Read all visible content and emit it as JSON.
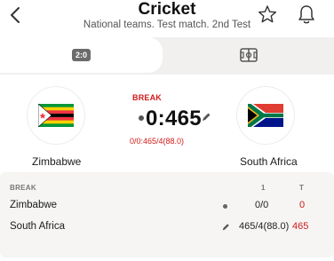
{
  "header": {
    "title": "Cricket",
    "subtitle": "National teams. Test match. 2nd Test",
    "icons": {
      "back": "chevron-left-icon",
      "favorite": "star-outline-icon",
      "notifications": "bell-icon"
    }
  },
  "tabs": [
    {
      "label": "2:0",
      "icon": "scoreboard-icon",
      "active": true
    },
    {
      "label": "",
      "icon": "field-icon",
      "active": false
    }
  ],
  "match": {
    "status": "BREAK",
    "score": "0:465",
    "detail": "0/0:465/4(88.0)",
    "home": {
      "name": "Zimbabwe",
      "flag": "zimbabwe-flag"
    },
    "away": {
      "name": "South Africa",
      "flag": "south-africa-flag"
    }
  },
  "scoreboard": {
    "status": "BREAK",
    "columns": [
      "1",
      "T"
    ],
    "rows": [
      {
        "team": "Zimbabwe",
        "indicator": "batting-dot-icon",
        "innings1": "0/0",
        "total": "0"
      },
      {
        "team": "South Africa",
        "indicator": "pencil-icon",
        "innings1": "465/4(88.0)",
        "total": "465"
      }
    ]
  },
  "colors": {
    "accent_red": "#d11a1a",
    "tab_bg": "#f1f0ef",
    "panel_bg": "#f6f5f4"
  }
}
